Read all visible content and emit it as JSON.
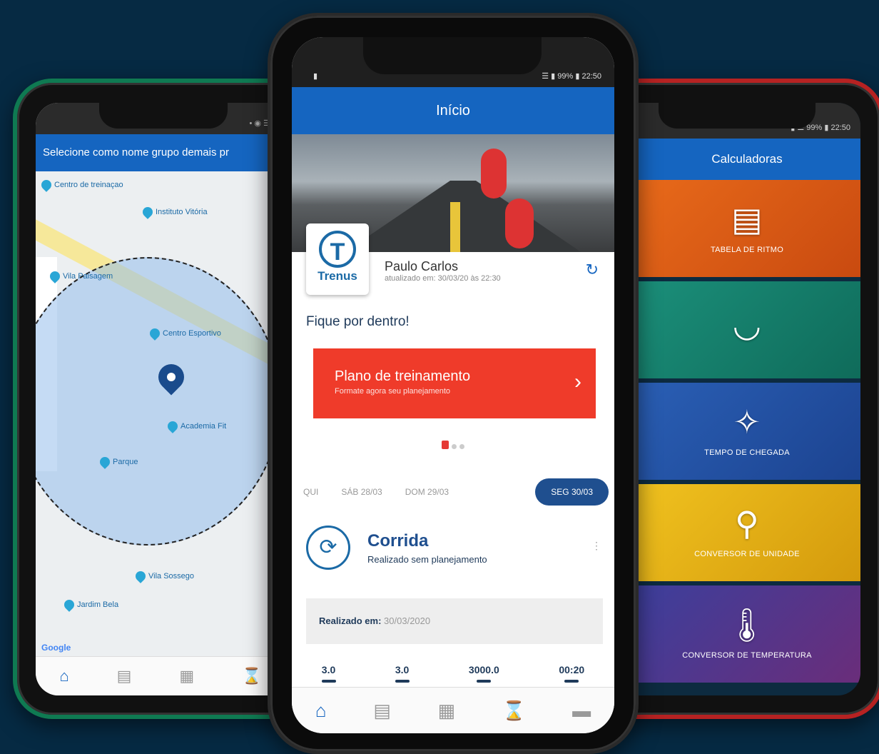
{
  "colors": {
    "brand": "#1565c0",
    "plan_card": "#ef3b2a",
    "left_frame": "#0f7a52",
    "right_frame": "#b62222"
  },
  "left": {
    "status": "• ◉ ☰ ▮",
    "header": "Selecione como nome grupo demais pr",
    "map_labels": {
      "poi1": "Centro de treinaçao",
      "poi2": "Instituto Vitória",
      "poi3": "Vila Paisagem",
      "poi4": "Centro Esportivo",
      "poi5": "Academia Fit",
      "poi6": "Parque",
      "poi7": "Vila Sossego",
      "poi8": "Jardim Bela",
      "google": "Google"
    },
    "nav": [
      "home-icon",
      "chat-icon",
      "clipboard-icon",
      "watch-icon"
    ]
  },
  "center": {
    "status_left": "▮",
    "status_right": "☰ ▮ 99% ▮ 22:50",
    "header": "Início",
    "logo_letter": "T",
    "logo_text": "Trenus",
    "profile_name": "Paulo Carlos",
    "profile_update": "atualizado em: 30/03/20 às 22:30",
    "section_title": "Fique por dentro!",
    "plan_title": "Plano de treinamento",
    "plan_sub": "Formate agora seu planejamento",
    "dates": [
      "QUI",
      "SÁB 28/03",
      "DOM 29/03"
    ],
    "date_active": "SEG 30/03",
    "activity_title": "Corrida",
    "activity_sub": "Realizado sem planejamento",
    "done_label": "Realizado em:",
    "done_value": "30/03/2020",
    "stats": [
      "3.0",
      "3.0",
      "3000.0",
      "00:20"
    ]
  },
  "right": {
    "status": "▮ ☰ 99% ▮ 22:50",
    "header": "Calculadoras",
    "tiles": [
      {
        "label": "TABELA DE RITMO",
        "icon": "table-icon",
        "color": "#e86a1a"
      },
      {
        "label": "",
        "icon": "speedometer-icon",
        "color": "#1b8f7a"
      },
      {
        "label": "TEMPO DE CHEGADA",
        "icon": "finish-icon",
        "color": "#2a5fb5"
      },
      {
        "label": "CONVERSOR DE UNIDADE",
        "icon": "location-icon",
        "color": "#e6b317"
      },
      {
        "label": "CONVERSOR DE TEMPERATURA",
        "icon": "thermometer-icon",
        "color": "#3c3f9c"
      }
    ]
  }
}
